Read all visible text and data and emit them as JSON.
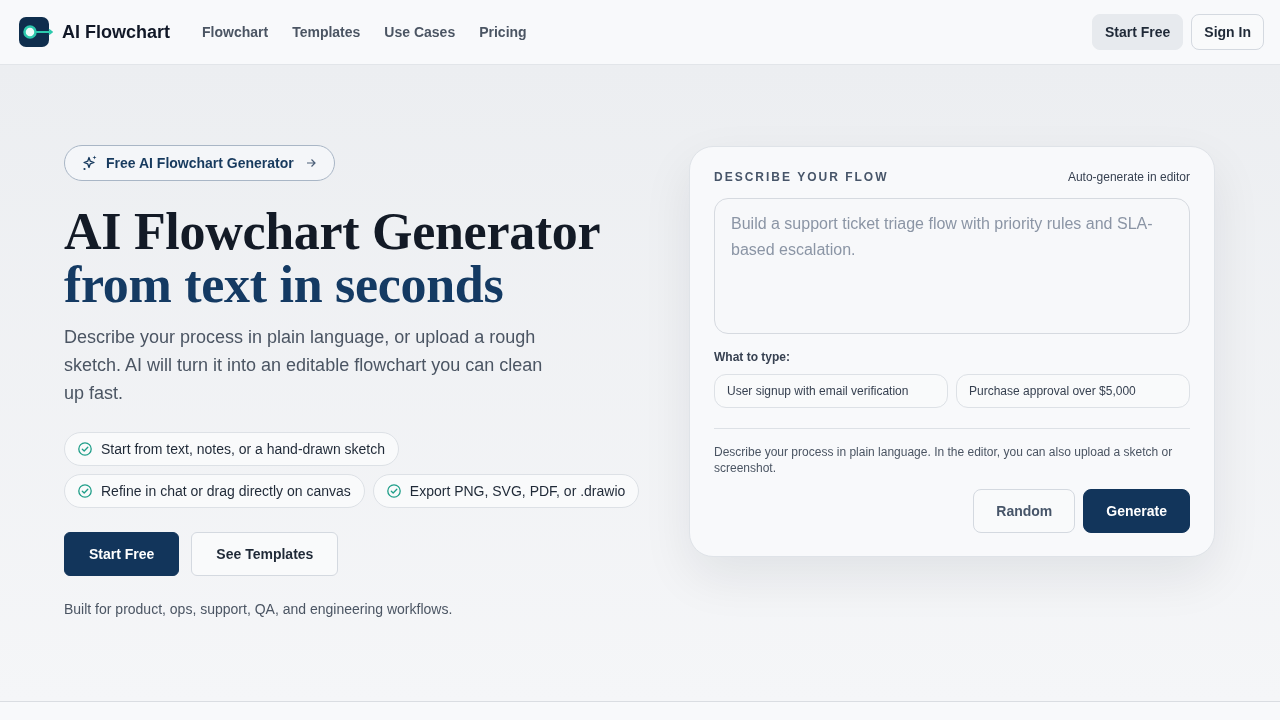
{
  "header": {
    "brand": "AI Flowchart",
    "nav": [
      {
        "label": "Flowchart"
      },
      {
        "label": "Templates"
      },
      {
        "label": "Use Cases"
      },
      {
        "label": "Pricing"
      }
    ],
    "actions": [
      {
        "label": "Start Free",
        "kind": "soft"
      },
      {
        "label": "Sign In",
        "kind": "outline"
      }
    ]
  },
  "hero": {
    "badge": "Free AI Flowchart Generator",
    "title": [
      {
        "text": "AI Flowchart Generator",
        "kind": "plain"
      },
      {
        "text": "from text in seconds",
        "kind": "accent"
      }
    ],
    "description": "Describe your process in plain language, or upload a rough sketch. AI will turn it into an editable flowchart you can clean up fast.",
    "features": [
      "Start from text, notes, or a hand-drawn sketch",
      "Refine in chat or drag directly on canvas",
      "Export PNG, SVG, PDF, or .drawio"
    ],
    "buttons": [
      {
        "label": "Start Free",
        "kind": "primary"
      },
      {
        "label": "See Templates",
        "kind": "outline"
      }
    ],
    "footnote": "Built for product, ops, support, QA, and engineering workflows."
  },
  "composer": {
    "title": "DESCRIBE YOUR FLOW",
    "hint": "Auto-generate in editor",
    "prompt": {
      "placeholder": "Build a support ticket triage flow with priority rules and SLA-based escalation."
    },
    "examples_label": "What to type:",
    "examples": [
      "User signup with email verification",
      "Purchase approval over $5,000"
    ],
    "note": "Describe your process in plain language. In the editor, you can also upload a sketch or screenshot.",
    "buttons": [
      {
        "label": "Random",
        "kind": "outline"
      },
      {
        "label": "Generate",
        "kind": "primary"
      }
    ]
  }
}
